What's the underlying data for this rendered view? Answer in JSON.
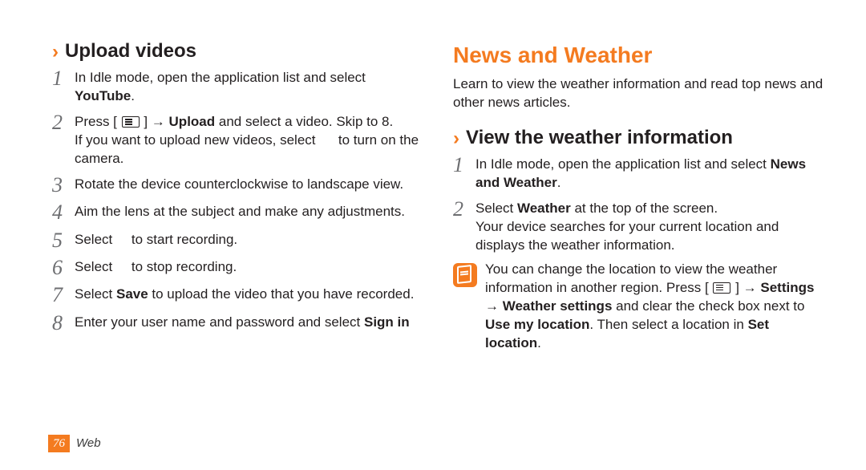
{
  "left": {
    "subhead": "Upload videos",
    "steps": [
      {
        "n": "1",
        "html": "In Idle mode, open the application list and select <b>YouTube</b>."
      },
      {
        "n": "2",
        "html": "Press [ <span class=\"menu-icon\" data-name=\"menu-icon\" data-interactable=\"false\"></span> ] → <b>Upload</b> and select a video. Skip to 8.<br>If you want to upload new videos, select &nbsp;&nbsp;&nbsp;&nbsp; to turn on the camera."
      },
      {
        "n": "3",
        "html": "Rotate the device counterclockwise to landscape view."
      },
      {
        "n": "4",
        "html": "Aim the lens at the subject and make any adjustments."
      },
      {
        "n": "5",
        "html": "Select &nbsp;&nbsp;&nbsp; to start recording."
      },
      {
        "n": "6",
        "html": "Select &nbsp;&nbsp;&nbsp; to stop recording."
      },
      {
        "n": "7",
        "html": "Select <b>Save</b> to upload the video that you have recorded."
      },
      {
        "n": "8",
        "html": "Enter your user name and password and select <b>Sign in</b>"
      }
    ]
  },
  "right": {
    "h1": "News and Weather",
    "intro": "Learn to view the weather information and read top news and other news articles.",
    "subhead": "View the weather information",
    "steps": [
      {
        "n": "1",
        "html": "In Idle mode, open the application list and select <b>News and Weather</b>."
      },
      {
        "n": "2",
        "html": "Select <b>Weather</b> at the top of the screen.<br>Your device searches for your current location and displays the weather information."
      }
    ],
    "note": "You can change the location to view the weather information in another region. Press [ <span class=\"menu-icon\" data-name=\"menu-icon\" data-interactable=\"false\"></span> ] → <b>Settings</b> → <b>Weather settings</b> and clear the check box next to <b>Use my location</b>. Then select a location in <b>Set location</b>."
  },
  "footer": {
    "page": "76",
    "section": "Web"
  }
}
